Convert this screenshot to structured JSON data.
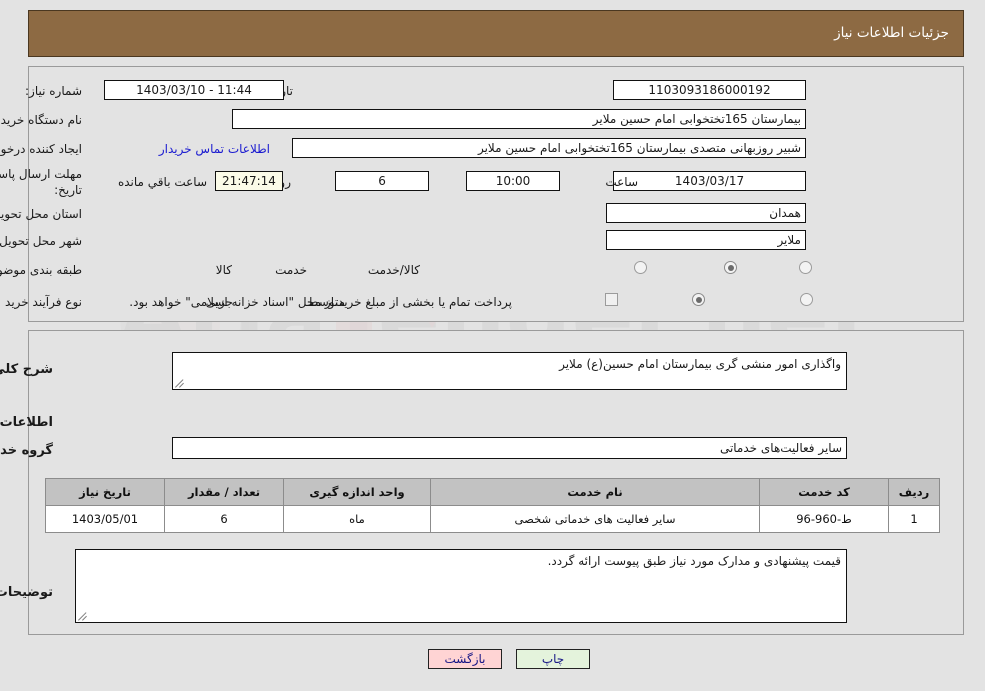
{
  "header": {
    "title": "جزئیات اطلاعات نیاز",
    "bg_color": "#8d6a43",
    "text_color": "#ffffff"
  },
  "form": {
    "labels": {
      "need_number": "شماره نیاز:",
      "buyer_org": "نام دستگاه خریدار:",
      "request_creator": "ایجاد کننده درخواست:",
      "deadline_line1": "مهلت ارسال پاسخ: تا",
      "deadline_line2": "تاریخ:",
      "delivery_province": "استان محل تحویل:",
      "delivery_city": "شهر محل تحویل:",
      "subject_category": "طبقه بندی موضوعی:",
      "purchase_process": "نوع فرآیند خرید :",
      "public_announce": "تاریخ و ساعت اعلان عمومي:",
      "hour": "ساعت",
      "day_and": "روز و",
      "remaining": "ساعت باقي مانده",
      "contact_link": "اطلاعات تماس خریدار"
    },
    "values": {
      "need_number": "1103093186000192",
      "buyer_org": "بیمارستان 165تختخوابی امام حسین ملایر",
      "request_creator": "شبیر روزبهانی متصدی بیمارستان 165تختخوابی امام حسین ملایر",
      "deadline_date": "1403/03/17",
      "deadline_hour": "10:00",
      "remaining_days": "6",
      "remaining_time": "21:47:14",
      "public_announce": "11:44 - 1403/03/10",
      "delivery_province": "همدان",
      "delivery_city": "ملایر"
    },
    "subject_category_options": [
      {
        "label": "کالا",
        "selected": false
      },
      {
        "label": "خدمت",
        "selected": true
      },
      {
        "label": "کالا/خدمت",
        "selected": false
      }
    ],
    "purchase_process_options": [
      {
        "label": "جزیی",
        "selected": false
      },
      {
        "label": "متوسط",
        "selected": true
      }
    ],
    "treasury_checkbox": {
      "label": "پرداخت تمام یا بخشی از مبلغ خرید،از محل \"اسناد خزانه اسلامی\" خواهد بود.",
      "checked": false
    }
  },
  "middle": {
    "need_description_label": "شرح کلي نیاز:",
    "need_description_value": "واگذاری امور منشی گری بیمارستان امام حسین(ع) ملایر",
    "services_section_title": "اطلاعات خدمات مورد نیاز",
    "service_group_label": "گروه خدمت:",
    "service_group_value": "سایر فعالیت‌های خدماتی",
    "buyer_notes_label": "توضیحات خریدار:",
    "buyer_notes_value": "قیمت پیشنهادی و مدارک مورد نیاز طبق پیوست ارائه گردد."
  },
  "table": {
    "columns": [
      "ردیف",
      "کد خدمت",
      "نام خدمت",
      "واحد اندازه گیری",
      "تعداد / مقدار",
      "تاریخ نیاز"
    ],
    "rows": [
      {
        "row_no": "1",
        "service_code": "ط-960-96",
        "service_name": "سایر فعالیت های خدماتی شخصی",
        "unit": "ماه",
        "quantity": "6",
        "need_date": "1403/05/01"
      }
    ]
  },
  "footer": {
    "back_button": "بازگشت",
    "print_button": "چاپ",
    "back_color": "#ffd4d4",
    "print_color": "#e4f3dc"
  },
  "watermark": {
    "text": "AriaTender.net"
  }
}
